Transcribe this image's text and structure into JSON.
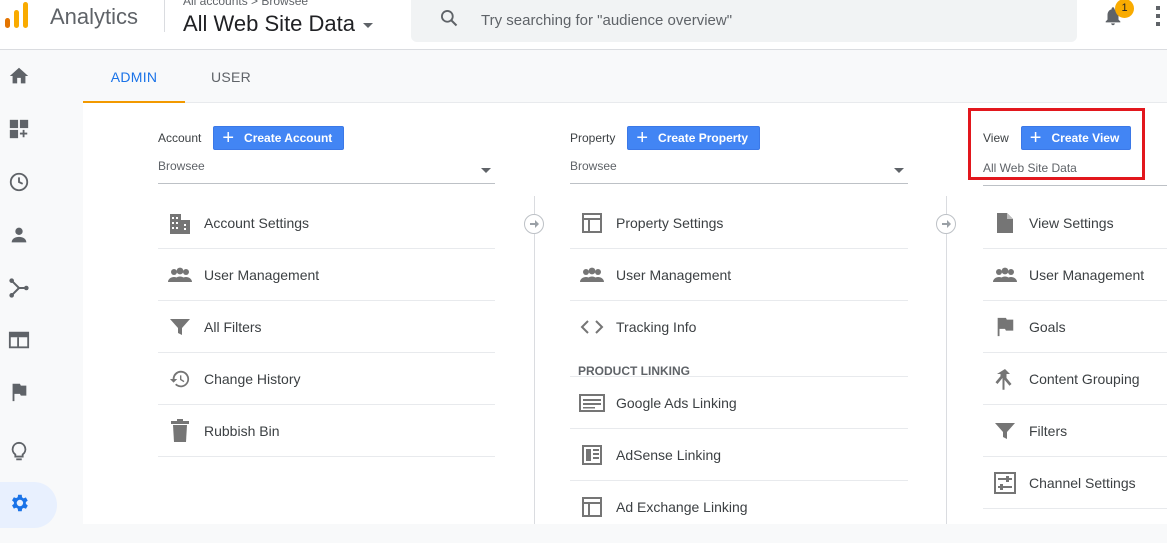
{
  "header": {
    "app_name": "Analytics",
    "breadcrumb": "All accounts > Browsee",
    "property_title": "All Web Site Data",
    "search_placeholder": "Try searching for \"audience overview\"",
    "notification_count": "1",
    "colors": {
      "logo_orange": "#f9ab00",
      "logo_dark": "#e37400",
      "badge": "#f9ab00"
    }
  },
  "sidenav": {
    "items": [
      {
        "icon": "home-icon"
      },
      {
        "icon": "customization-icon"
      },
      {
        "icon": "realtime-clock-icon"
      },
      {
        "icon": "audience-person-icon"
      },
      {
        "icon": "acquisition-icon"
      },
      {
        "icon": "behavior-icon"
      },
      {
        "icon": "conversions-flag-icon"
      },
      {
        "icon": "discover-bulb-icon"
      },
      {
        "icon": "admin-gear-icon",
        "active": true
      }
    ]
  },
  "tabs": {
    "admin": "ADMIN",
    "user": "USER"
  },
  "columns": {
    "account": {
      "label": "Account",
      "create_button": "Create Account",
      "selected": "Browsee",
      "items": [
        {
          "label": "Account Settings",
          "icon": "building-icon"
        },
        {
          "label": "User Management",
          "icon": "people-icon"
        },
        {
          "label": "All Filters",
          "icon": "filter-icon"
        },
        {
          "label": "Change History",
          "icon": "history-icon"
        },
        {
          "label": "Rubbish Bin",
          "icon": "trash-icon"
        }
      ]
    },
    "property": {
      "label": "Property",
      "create_button": "Create Property",
      "selected": "Browsee",
      "items": [
        {
          "label": "Property Settings",
          "icon": "window-icon"
        },
        {
          "label": "User Management",
          "icon": "people-icon"
        },
        {
          "label": "Tracking Info",
          "icon": "code-icon"
        }
      ],
      "section": "PRODUCT LINKING",
      "linking_items": [
        {
          "label": "Google Ads Linking",
          "icon": "ads-icon"
        },
        {
          "label": "AdSense Linking",
          "icon": "adsense-icon"
        },
        {
          "label": "Ad Exchange Linking",
          "icon": "window-icon"
        }
      ]
    },
    "view": {
      "label": "View",
      "create_button": "Create View",
      "selected": "All Web Site Data",
      "items": [
        {
          "label": "View Settings",
          "icon": "document-icon"
        },
        {
          "label": "User Management",
          "icon": "people-icon"
        },
        {
          "label": "Goals",
          "icon": "goal-flag-icon"
        },
        {
          "label": "Content Grouping",
          "icon": "merge-icon"
        },
        {
          "label": "Filters",
          "icon": "filter-icon"
        },
        {
          "label": "Channel Settings",
          "icon": "channel-settings-icon"
        }
      ]
    }
  },
  "accent_color": "#1a73e8",
  "button_color": "#4285f4",
  "highlight_color": "#e2171d"
}
